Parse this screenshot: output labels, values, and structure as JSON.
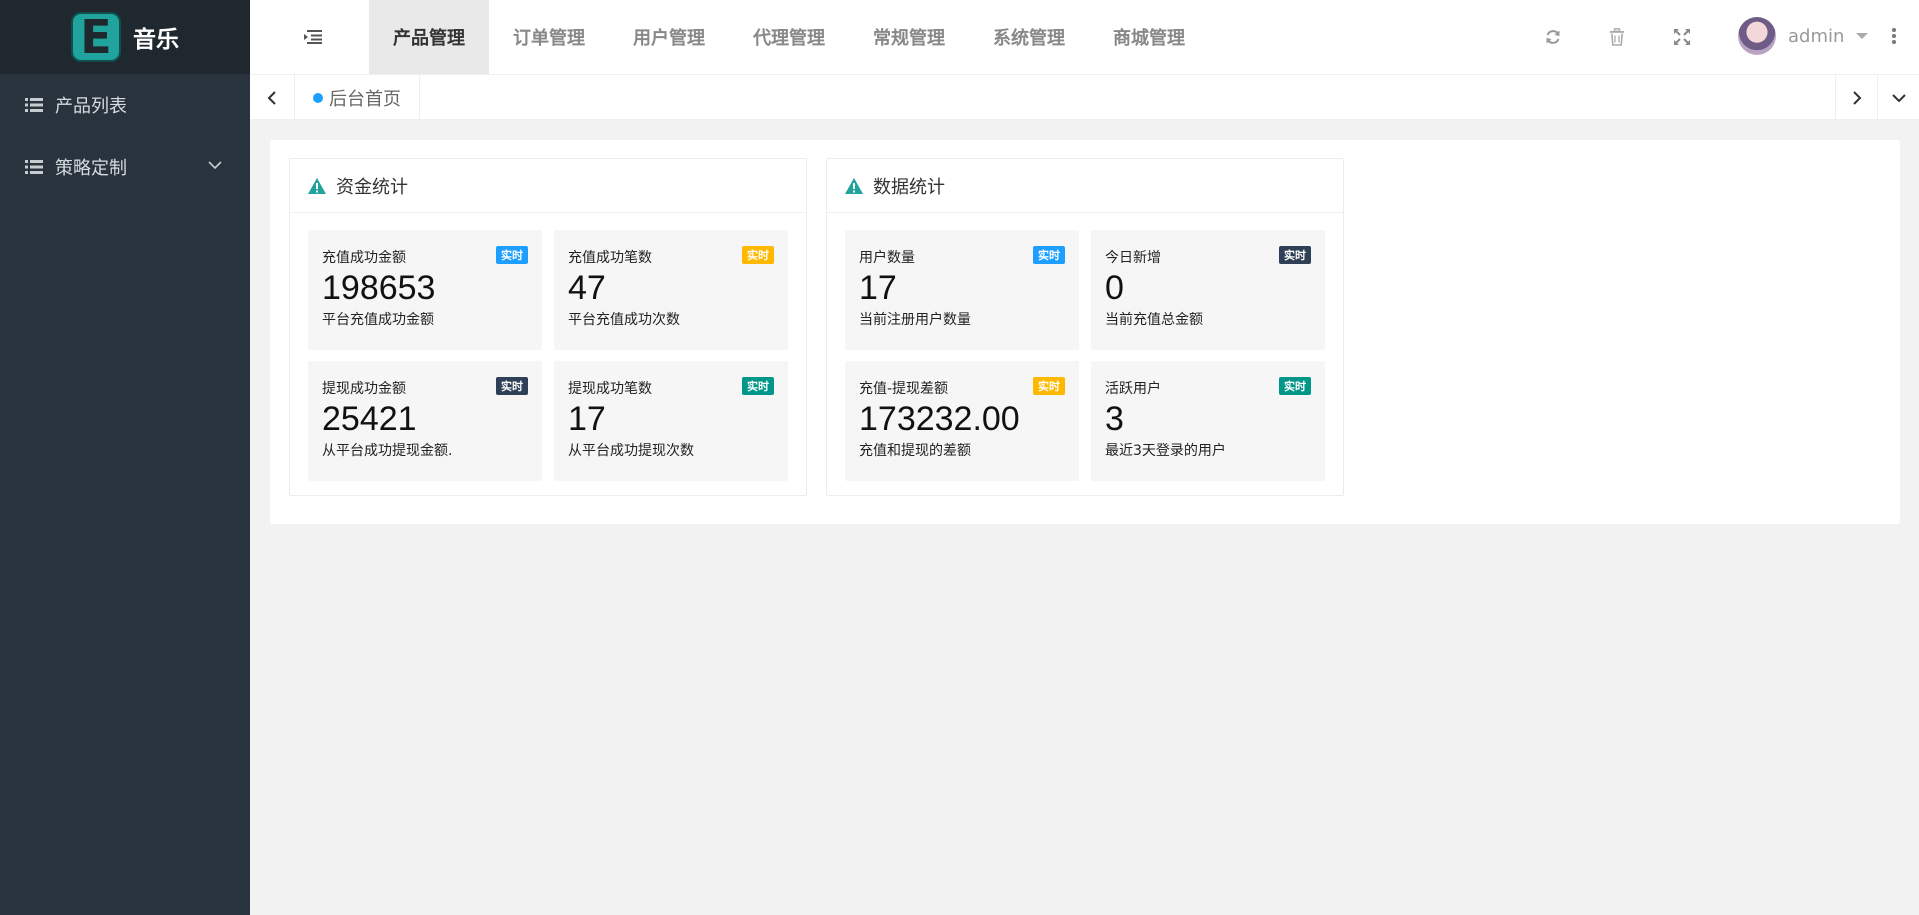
{
  "app": {
    "logo_letter": "E",
    "logo_text": "音乐"
  },
  "sidebar": {
    "items": [
      {
        "label": "产品列表"
      },
      {
        "label": "策略定制"
      }
    ]
  },
  "topnav": {
    "items": [
      "产品管理",
      "订单管理",
      "用户管理",
      "代理管理",
      "常规管理",
      "系统管理",
      "商城管理"
    ],
    "active_index": 0
  },
  "user": {
    "name": "admin"
  },
  "tabs": {
    "home_label": "后台首页"
  },
  "panels": {
    "funds": {
      "title": "资金统计",
      "cards": [
        {
          "title": "充值成功金额",
          "badge": "实时",
          "badge_color": "#1e9fff",
          "value": "198653",
          "desc": "平台充值成功金额"
        },
        {
          "title": "充值成功笔数",
          "badge": "实时",
          "badge_color": "#ffb800",
          "value": "47",
          "desc": "平台充值成功次数"
        },
        {
          "title": "提现成功金额",
          "badge": "实时",
          "badge_color": "#2f4056",
          "value": "25421",
          "desc": "从平台成功提现金额."
        },
        {
          "title": "提现成功笔数",
          "badge": "实时",
          "badge_color": "#009688",
          "value": "17",
          "desc": "从平台成功提现次数"
        }
      ]
    },
    "data": {
      "title": "数据统计",
      "cards": [
        {
          "title": "用户数量",
          "badge": "实时",
          "badge_color": "#1e9fff",
          "value": "17",
          "desc": "当前注册用户数量"
        },
        {
          "title": "今日新增",
          "badge": "实时",
          "badge_color": "#2f4056",
          "value": "0",
          "desc": "当前充值总金额"
        },
        {
          "title": "充值-提现差额",
          "badge": "实时",
          "badge_color": "#ffb800",
          "value": "173232.00",
          "desc": "充值和提现的差额"
        },
        {
          "title": "活跃用户",
          "badge": "实时",
          "badge_color": "#009688",
          "value": "3",
          "desc": "最近3天登录的用户"
        }
      ]
    }
  },
  "colors": {
    "sidebar_bg": "#28333e",
    "logo_bg": "#20282f",
    "accent": "#1fa39c",
    "panel_icon": "#1fa39c"
  },
  "icons": [
    "list-icon",
    "chevron-down-icon",
    "fold-menu-icon",
    "refresh-icon",
    "trash-icon",
    "fullscreen-icon",
    "caret-down-icon",
    "more-vertical-icon",
    "chevron-left-icon",
    "chevron-right-icon",
    "warning-icon"
  ]
}
